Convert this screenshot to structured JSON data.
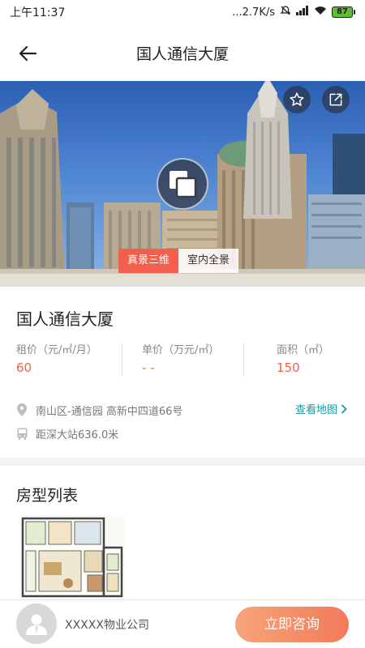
{
  "status_bar": {
    "time": "上午11:37",
    "network_speed": "...2.7K/s",
    "battery": "87",
    "icons": [
      "mute-icon",
      "signal-icon",
      "wifi-icon",
      "battery-icon"
    ]
  },
  "nav": {
    "title": "国人通信大厦",
    "back_icon": "arrow-left-icon"
  },
  "hero": {
    "favorite_icon": "star-icon",
    "share_icon": "share-icon",
    "view_icon": "overlap-squares-icon",
    "tabs": [
      {
        "label": "真景三维",
        "active": true
      },
      {
        "label": "室内全景",
        "active": false
      }
    ]
  },
  "building": {
    "name": "国人通信大厦",
    "stats": [
      {
        "label": "租价（元/㎡/月）",
        "value": "60"
      },
      {
        "label": "单价（万元/㎡）",
        "value": "- -"
      },
      {
        "label": "面积（㎡）",
        "value": "150"
      }
    ],
    "address": "南山区-通信园 高新中四道66号",
    "map_link": "查看地图",
    "transit": "距深大站636.0米"
  },
  "floor_plans": {
    "title": "房型列表"
  },
  "bottom": {
    "company": "XXXXX物业公司",
    "consult_button": "立即咨询"
  },
  "colors": {
    "accent": "#f25f4c",
    "link": "#179aa4",
    "button_gradient_start": "#f6a57a",
    "button_gradient_end": "#f27a5a"
  }
}
